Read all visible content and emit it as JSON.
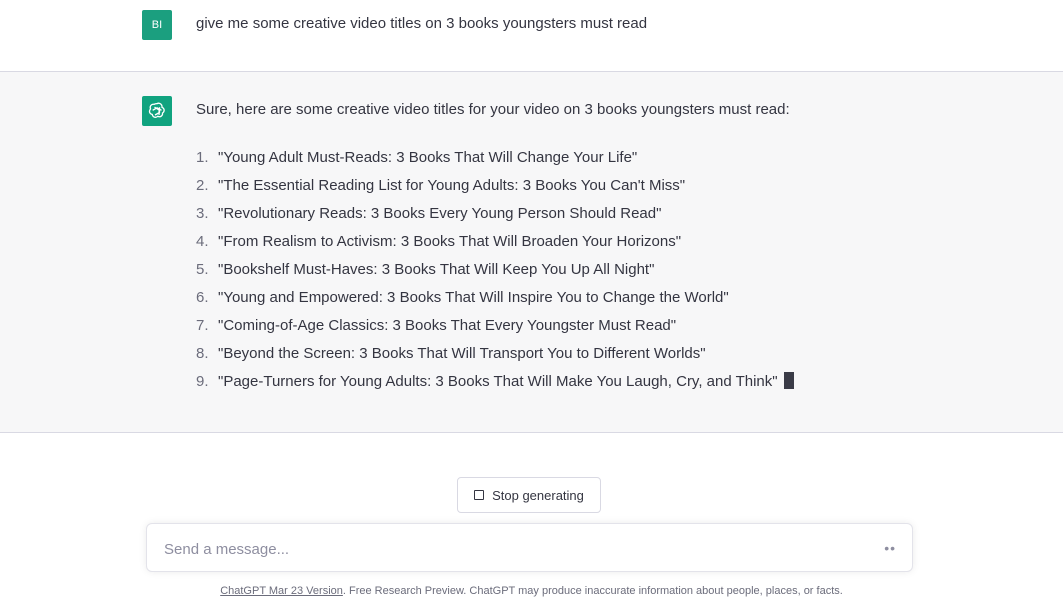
{
  "user_message": {
    "avatar_initials": "BI",
    "text": "give me some creative video titles on 3 books youngsters must read"
  },
  "assistant_message": {
    "avatar_icon": "openai-logo-icon",
    "intro": "Sure, here are some creative video titles for your video on 3 books youngsters must read:",
    "items": [
      {
        "num": "1.",
        "text": "\"Young Adult Must-Reads: 3 Books That Will Change Your Life\""
      },
      {
        "num": "2.",
        "text": "\"The Essential Reading List for Young Adults: 3 Books You Can't Miss\""
      },
      {
        "num": "3.",
        "text": "\"Revolutionary Reads: 3 Books Every Young Person Should Read\""
      },
      {
        "num": "4.",
        "text": "\"From Realism to Activism: 3 Books That Will Broaden Your Horizons\""
      },
      {
        "num": "5.",
        "text": "\"Bookshelf Must-Haves: 3 Books That Will Keep You Up All Night\""
      },
      {
        "num": "6.",
        "text": "\"Young and Empowered: 3 Books That Will Inspire You to Change the World\""
      },
      {
        "num": "7.",
        "text": "\"Coming-of-Age Classics: 3 Books That Every Youngster Must Read\""
      },
      {
        "num": "8.",
        "text": "\"Beyond the Screen: 3 Books That Will Transport You to Different Worlds\""
      },
      {
        "num": "9.",
        "text": "\"Page-Turners for Young Adults: 3 Books That Will Make You Laugh, Cry, and Think\""
      }
    ]
  },
  "controls": {
    "stop_label": "Stop generating",
    "input_placeholder": "Send a message...",
    "input_value": "",
    "send_icon": "loading-dots-icon"
  },
  "footer": {
    "link_text": "ChatGPT Mar 23 Version",
    "text": ". Free Research Preview. ChatGPT may produce inaccurate information about people, places, or facts."
  },
  "colors": {
    "user_avatar": "#1b9f7f",
    "bot_avatar": "#10a37f",
    "assistant_bg": "#f7f7f8",
    "text": "#343541"
  }
}
